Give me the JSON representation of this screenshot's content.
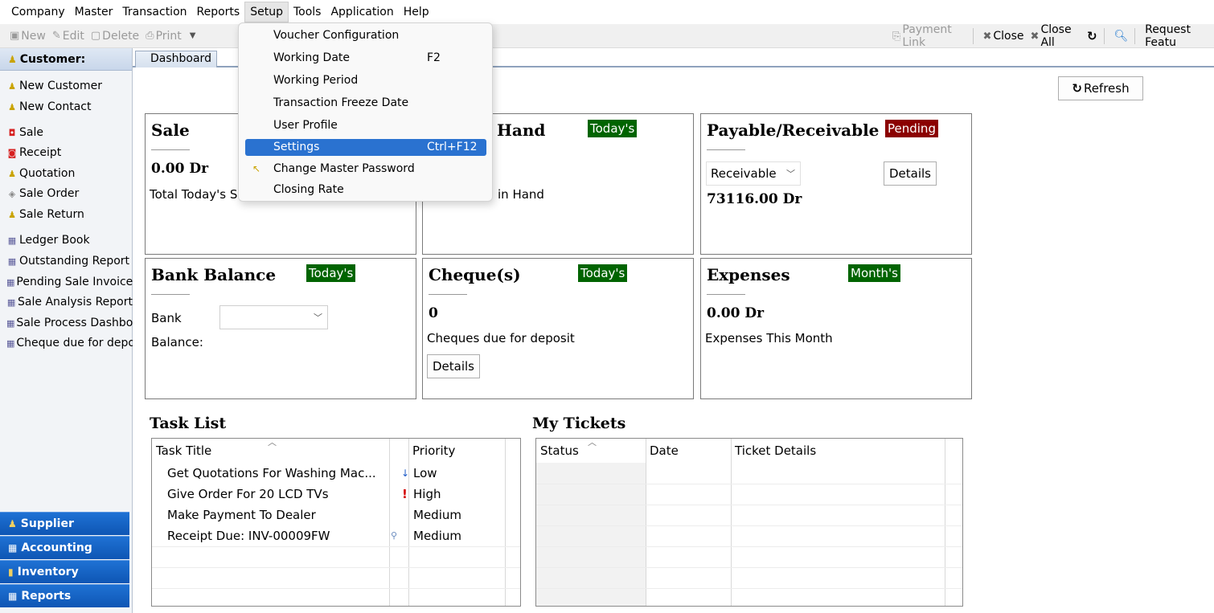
{
  "menubar": {
    "items": [
      "Company",
      "Master",
      "Transaction",
      "Reports",
      "Setup",
      "Tools",
      "Application",
      "Help"
    ]
  },
  "toolbar": {
    "new": "New",
    "edit": "Edit",
    "delete": "Delete",
    "print": "Print",
    "payment_link": "Payment Link",
    "close": "Close",
    "close_all": "Close All",
    "request": "Request Featu"
  },
  "sidebar": {
    "header": "Customer:",
    "items": [
      "New Customer",
      "New Contact",
      "Sale",
      "Receipt",
      "Quotation",
      "Sale Order",
      "Sale Return",
      "Ledger Book",
      "Outstanding Report",
      "Pending Sale Invoices",
      "Sale Analysis Report",
      "Sale Process Dashboa",
      "Cheque due for depos"
    ],
    "bottom": [
      "Supplier",
      "Accounting",
      "Inventory",
      "Reports"
    ]
  },
  "tab": {
    "label": "Dashboard"
  },
  "refresh": "Refresh",
  "cards": {
    "sale": {
      "title": "Sale",
      "value": "0.00 Dr",
      "desc": "Total Today's S"
    },
    "cash": {
      "title": "Hand",
      "badge": "Today's",
      "desc": "in Hand"
    },
    "payable": {
      "title": "Payable/Receivable",
      "badge": "Pending",
      "select": "Receivable",
      "details": "Details",
      "value": "73116.00 Dr"
    },
    "bank": {
      "title": "Bank Balance",
      "badge": "Today's",
      "bank_label": "Bank",
      "balance_label": "Balance:"
    },
    "cheques": {
      "title": "Cheque(s)",
      "badge": "Today's",
      "value": "0",
      "desc": "Cheques due for deposit",
      "details": "Details"
    },
    "expenses": {
      "title": "Expenses",
      "badge": "Month's",
      "value": "0.00 Dr",
      "desc": "Expenses This Month"
    }
  },
  "tasks": {
    "title": "Task List",
    "headers": [
      "Task Title",
      "Priority"
    ],
    "rows": [
      {
        "title": "Get Quotations For Washing Mac...",
        "priority": "Low"
      },
      {
        "title": "Give Order For 20 LCD TVs",
        "priority": "High"
      },
      {
        "title": "Make Payment To Dealer",
        "priority": "Medium"
      },
      {
        "title": "Receipt Due: INV-00009FW",
        "priority": "Medium"
      }
    ]
  },
  "tickets": {
    "title": "My Tickets",
    "headers": [
      "Status",
      "Date",
      "Ticket Details"
    ]
  },
  "setup_menu": {
    "items": [
      {
        "label": "Voucher Configuration",
        "shortcut": ""
      },
      {
        "label": "Working Date",
        "shortcut": "F2"
      },
      {
        "label": "Working Period",
        "shortcut": ""
      },
      {
        "label": "Transaction Freeze Date",
        "shortcut": ""
      },
      {
        "label": "User Profile",
        "shortcut": ""
      },
      {
        "label": "Settings",
        "shortcut": "Ctrl+F12"
      },
      {
        "label": "Change Master Password",
        "shortcut": ""
      },
      {
        "label": "Closing Rate",
        "shortcut": ""
      }
    ]
  }
}
